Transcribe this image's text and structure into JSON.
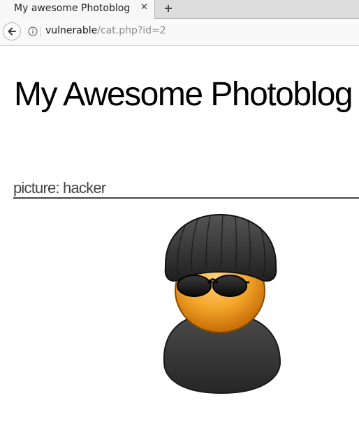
{
  "browser": {
    "tab_title": "My awesome Photoblog",
    "tab_close": "✕",
    "new_tab": "+",
    "url_host": "vulnerable",
    "url_path": "/cat.php?id=2"
  },
  "page": {
    "title": "My Awesome Photoblog",
    "picture_heading": "picture: hacker"
  },
  "colors": {
    "tab_active": "#f7f7f7",
    "tabbar": "#dcdcdc",
    "navbar": "#f9f9f9",
    "heading_text": "#444444",
    "hacker_face": "#f2a327",
    "hacker_body": "#3a3a3a"
  },
  "icons": {
    "back": "arrow-left-icon",
    "info": "info-circle-icon",
    "close": "close-icon",
    "new_tab": "plus-icon"
  }
}
